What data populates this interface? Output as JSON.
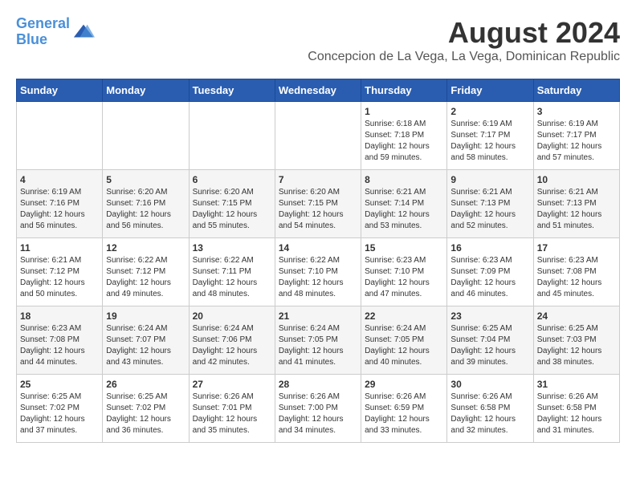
{
  "logo": {
    "line1": "General",
    "line2": "Blue"
  },
  "title": "August 2024",
  "subtitle": "Concepcion de La Vega, La Vega, Dominican Republic",
  "weekdays": [
    "Sunday",
    "Monday",
    "Tuesday",
    "Wednesday",
    "Thursday",
    "Friday",
    "Saturday"
  ],
  "weeks": [
    [
      {
        "day": "",
        "info": ""
      },
      {
        "day": "",
        "info": ""
      },
      {
        "day": "",
        "info": ""
      },
      {
        "day": "",
        "info": ""
      },
      {
        "day": "1",
        "info": "Sunrise: 6:18 AM\nSunset: 7:18 PM\nDaylight: 12 hours\nand 59 minutes."
      },
      {
        "day": "2",
        "info": "Sunrise: 6:19 AM\nSunset: 7:17 PM\nDaylight: 12 hours\nand 58 minutes."
      },
      {
        "day": "3",
        "info": "Sunrise: 6:19 AM\nSunset: 7:17 PM\nDaylight: 12 hours\nand 57 minutes."
      }
    ],
    [
      {
        "day": "4",
        "info": "Sunrise: 6:19 AM\nSunset: 7:16 PM\nDaylight: 12 hours\nand 56 minutes."
      },
      {
        "day": "5",
        "info": "Sunrise: 6:20 AM\nSunset: 7:16 PM\nDaylight: 12 hours\nand 56 minutes."
      },
      {
        "day": "6",
        "info": "Sunrise: 6:20 AM\nSunset: 7:15 PM\nDaylight: 12 hours\nand 55 minutes."
      },
      {
        "day": "7",
        "info": "Sunrise: 6:20 AM\nSunset: 7:15 PM\nDaylight: 12 hours\nand 54 minutes."
      },
      {
        "day": "8",
        "info": "Sunrise: 6:21 AM\nSunset: 7:14 PM\nDaylight: 12 hours\nand 53 minutes."
      },
      {
        "day": "9",
        "info": "Sunrise: 6:21 AM\nSunset: 7:13 PM\nDaylight: 12 hours\nand 52 minutes."
      },
      {
        "day": "10",
        "info": "Sunrise: 6:21 AM\nSunset: 7:13 PM\nDaylight: 12 hours\nand 51 minutes."
      }
    ],
    [
      {
        "day": "11",
        "info": "Sunrise: 6:21 AM\nSunset: 7:12 PM\nDaylight: 12 hours\nand 50 minutes."
      },
      {
        "day": "12",
        "info": "Sunrise: 6:22 AM\nSunset: 7:12 PM\nDaylight: 12 hours\nand 49 minutes."
      },
      {
        "day": "13",
        "info": "Sunrise: 6:22 AM\nSunset: 7:11 PM\nDaylight: 12 hours\nand 48 minutes."
      },
      {
        "day": "14",
        "info": "Sunrise: 6:22 AM\nSunset: 7:10 PM\nDaylight: 12 hours\nand 48 minutes."
      },
      {
        "day": "15",
        "info": "Sunrise: 6:23 AM\nSunset: 7:10 PM\nDaylight: 12 hours\nand 47 minutes."
      },
      {
        "day": "16",
        "info": "Sunrise: 6:23 AM\nSunset: 7:09 PM\nDaylight: 12 hours\nand 46 minutes."
      },
      {
        "day": "17",
        "info": "Sunrise: 6:23 AM\nSunset: 7:08 PM\nDaylight: 12 hours\nand 45 minutes."
      }
    ],
    [
      {
        "day": "18",
        "info": "Sunrise: 6:23 AM\nSunset: 7:08 PM\nDaylight: 12 hours\nand 44 minutes."
      },
      {
        "day": "19",
        "info": "Sunrise: 6:24 AM\nSunset: 7:07 PM\nDaylight: 12 hours\nand 43 minutes."
      },
      {
        "day": "20",
        "info": "Sunrise: 6:24 AM\nSunset: 7:06 PM\nDaylight: 12 hours\nand 42 minutes."
      },
      {
        "day": "21",
        "info": "Sunrise: 6:24 AM\nSunset: 7:05 PM\nDaylight: 12 hours\nand 41 minutes."
      },
      {
        "day": "22",
        "info": "Sunrise: 6:24 AM\nSunset: 7:05 PM\nDaylight: 12 hours\nand 40 minutes."
      },
      {
        "day": "23",
        "info": "Sunrise: 6:25 AM\nSunset: 7:04 PM\nDaylight: 12 hours\nand 39 minutes."
      },
      {
        "day": "24",
        "info": "Sunrise: 6:25 AM\nSunset: 7:03 PM\nDaylight: 12 hours\nand 38 minutes."
      }
    ],
    [
      {
        "day": "25",
        "info": "Sunrise: 6:25 AM\nSunset: 7:02 PM\nDaylight: 12 hours\nand 37 minutes."
      },
      {
        "day": "26",
        "info": "Sunrise: 6:25 AM\nSunset: 7:02 PM\nDaylight: 12 hours\nand 36 minutes."
      },
      {
        "day": "27",
        "info": "Sunrise: 6:26 AM\nSunset: 7:01 PM\nDaylight: 12 hours\nand 35 minutes."
      },
      {
        "day": "28",
        "info": "Sunrise: 6:26 AM\nSunset: 7:00 PM\nDaylight: 12 hours\nand 34 minutes."
      },
      {
        "day": "29",
        "info": "Sunrise: 6:26 AM\nSunset: 6:59 PM\nDaylight: 12 hours\nand 33 minutes."
      },
      {
        "day": "30",
        "info": "Sunrise: 6:26 AM\nSunset: 6:58 PM\nDaylight: 12 hours\nand 32 minutes."
      },
      {
        "day": "31",
        "info": "Sunrise: 6:26 AM\nSunset: 6:58 PM\nDaylight: 12 hours\nand 31 minutes."
      }
    ]
  ]
}
